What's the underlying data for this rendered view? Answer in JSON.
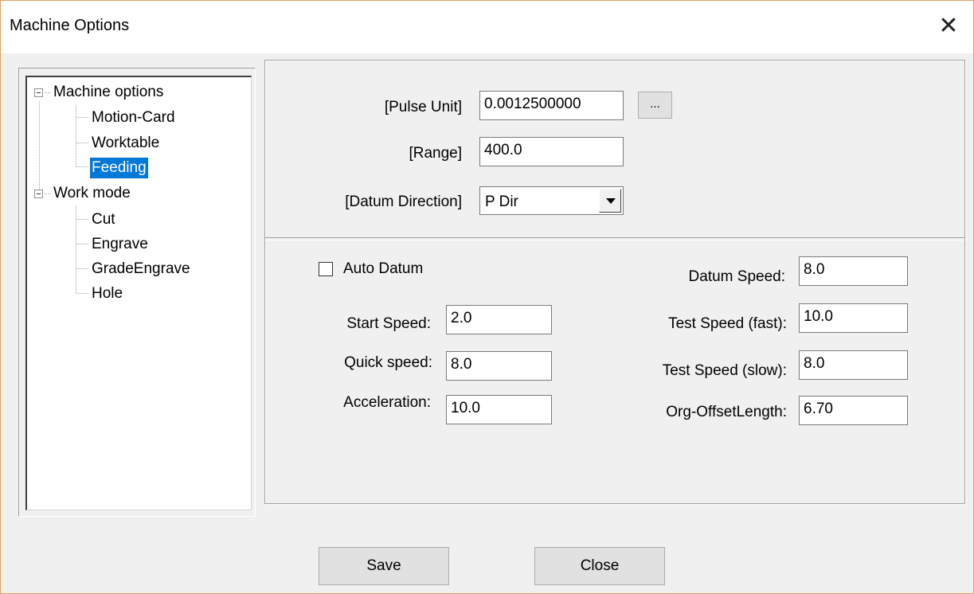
{
  "window": {
    "title": "Machine Options",
    "close_symbol": "✕"
  },
  "tree": {
    "items": [
      {
        "label": "Machine options",
        "level": 0,
        "expanded": true
      },
      {
        "label": "Motion-Card",
        "level": 1
      },
      {
        "label": "Worktable",
        "level": 1
      },
      {
        "label": "Feeding",
        "level": 1,
        "selected": true
      },
      {
        "label": "Work mode",
        "level": 0,
        "expanded": true
      },
      {
        "label": "Cut",
        "level": 1
      },
      {
        "label": "Engrave",
        "level": 1
      },
      {
        "label": "GradeEngrave",
        "level": 1
      },
      {
        "label": "Hole",
        "level": 1
      }
    ]
  },
  "top_section": {
    "pulse_unit_label": "[Pulse Unit]",
    "pulse_unit_value": "0.0012500000",
    "browse_label": "...",
    "range_label": "[Range]",
    "range_value": "400.0",
    "datum_direction_label": "[Datum Direction]",
    "datum_direction_value": "P Dir"
  },
  "bottom_section": {
    "auto_datum_label": "Auto Datum",
    "auto_datum_checked": false,
    "start_speed_label": "Start Speed:",
    "start_speed_value": "2.0",
    "quick_speed_label": "Quick speed:",
    "quick_speed_value": "8.0",
    "acceleration_label": "Acceleration:",
    "acceleration_value": "10.0",
    "datum_speed_label": "Datum Speed:",
    "datum_speed_value": "8.0",
    "test_speed_fast_label": "Test Speed (fast):",
    "test_speed_fast_value": "10.0",
    "test_speed_slow_label": "Test Speed (slow):",
    "test_speed_slow_value": "8.0",
    "org_offset_label": "Org-OffsetLength:",
    "org_offset_value": "6.70"
  },
  "footer": {
    "save_label": "Save",
    "close_label": "Close"
  },
  "colors": {
    "selection": "#0078d7",
    "window_bg": "#f0f0f0",
    "border_accent": "#e0a060"
  }
}
